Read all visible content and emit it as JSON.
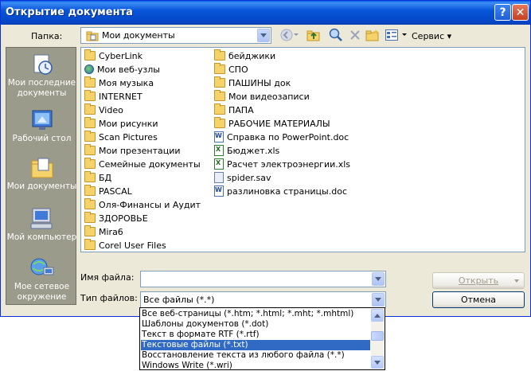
{
  "window": {
    "title": "Открытие документа"
  },
  "titlebar": {
    "help_label": "?",
    "close_label": "✕"
  },
  "toolbar": {
    "lookin_label": "Папка:",
    "lookin_value": "Мои документы",
    "service_label": "Сервис ▾",
    "icons": [
      "back-icon",
      "up-folder-icon",
      "search-web-icon",
      "delete-icon",
      "new-folder-icon",
      "views-icon"
    ]
  },
  "places": [
    {
      "label": "Мои последние документы",
      "icon": "recent-documents-icon"
    },
    {
      "label": "Рабочий стол",
      "icon": "desktop-icon"
    },
    {
      "label": "Мои документы",
      "icon": "my-documents-icon"
    },
    {
      "label": "Мой компьютер",
      "icon": "my-computer-icon"
    },
    {
      "label": "Мое сетевое окружение",
      "icon": "network-places-icon"
    }
  ],
  "files": {
    "column1": [
      {
        "name": "CyberLink",
        "type": "folder"
      },
      {
        "name": "Мои веб-узлы",
        "type": "web"
      },
      {
        "name": "Моя музыка",
        "type": "folder"
      },
      {
        "name": "INTERNET",
        "type": "folder"
      },
      {
        "name": "Video",
        "type": "folder"
      },
      {
        "name": "Мои рисунки",
        "type": "folder"
      },
      {
        "name": "Scan Pictures",
        "type": "folder"
      },
      {
        "name": "Мои презентации",
        "type": "folder"
      },
      {
        "name": "Семейные документы",
        "type": "folder"
      },
      {
        "name": "БД",
        "type": "folder"
      },
      {
        "name": "PASCAL",
        "type": "folder"
      },
      {
        "name": "Оля-Финансы и Аудит",
        "type": "folder"
      },
      {
        "name": "ЗДОРОВЬЕ",
        "type": "folder"
      },
      {
        "name": "Mira6",
        "type": "folder"
      },
      {
        "name": "Corel User Files",
        "type": "folder"
      }
    ],
    "column2": [
      {
        "name": "бейджики",
        "type": "folder"
      },
      {
        "name": "СПО",
        "type": "folder"
      },
      {
        "name": "ПАШИНЫ док",
        "type": "folder"
      },
      {
        "name": "Мои видеозаписи",
        "type": "folder"
      },
      {
        "name": "ПАПА",
        "type": "folder"
      },
      {
        "name": "РАБОЧИЕ МАТЕРИАЛЫ",
        "type": "folder"
      },
      {
        "name": "Справка по PowerPoint.doc",
        "type": "doc"
      },
      {
        "name": "Бюджет.xls",
        "type": "xls"
      },
      {
        "name": "Расчет электроэнергии.xls",
        "type": "xls"
      },
      {
        "name": "spider.sav",
        "type": "sav"
      },
      {
        "name": "разлиновка страницы.doc",
        "type": "doc"
      }
    ]
  },
  "form": {
    "filename_label": "Имя файла:",
    "filename_value": "",
    "filetype_label": "Тип файлов:",
    "filetype_value": "Все файлы (*.*)",
    "open_button": "Открыть",
    "cancel_button": "Отмена"
  },
  "filetype_options": [
    "Все веб-страницы (*.htm; *.html; *.mht; *.mhtml)",
    "Шаблоны документов (*.dot)",
    "Текст в формате RTF (*.rtf)",
    "Текстовые файлы (*.txt)",
    "Восстановление текста из любого файла (*.*)",
    "Windows Write (*.wri)"
  ],
  "filetype_selected_index": 3,
  "colors": {
    "titlebar": "#0854d6",
    "selection": "#316ac5",
    "places_bg": "#9b9b8c",
    "dialog_bg": "#ece9d8"
  }
}
